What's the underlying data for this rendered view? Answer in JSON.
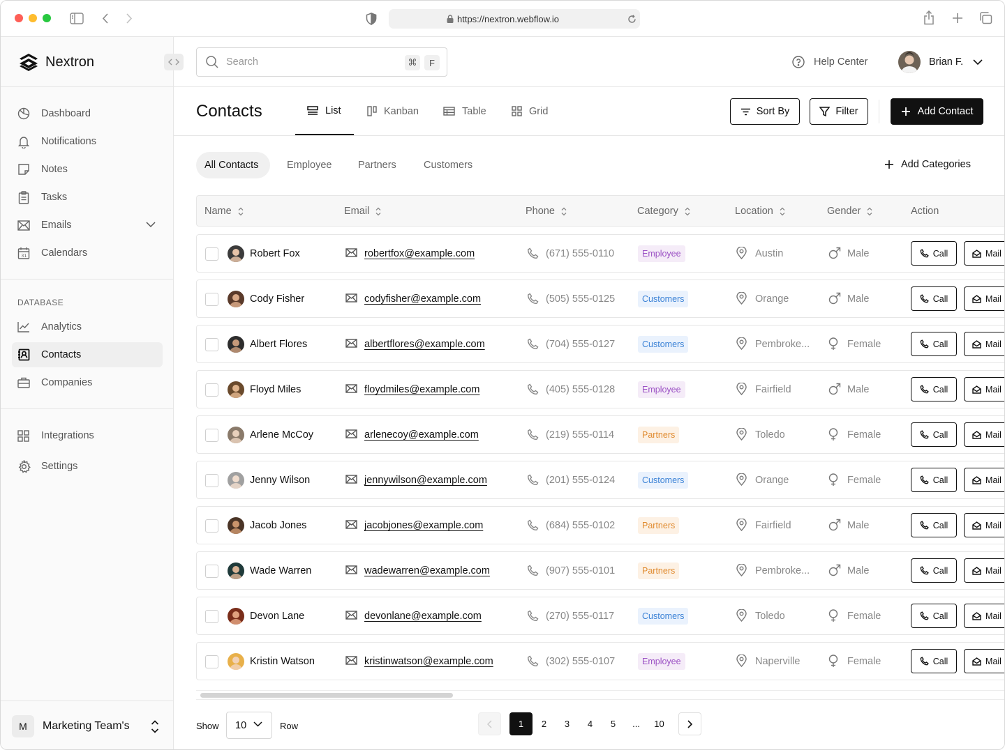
{
  "browser": {
    "url": "https://nextron.webflow.io"
  },
  "brand": {
    "name": "Nextron"
  },
  "sidebar": {
    "items": [
      {
        "label": "Dashboard",
        "icon": "dashboard-icon"
      },
      {
        "label": "Notifications",
        "icon": "bell-icon"
      },
      {
        "label": "Notes",
        "icon": "note-icon"
      },
      {
        "label": "Tasks",
        "icon": "clipboard-icon"
      },
      {
        "label": "Emails",
        "icon": "envelope-icon"
      },
      {
        "label": "Calendars",
        "icon": "calendar-icon"
      }
    ],
    "database_label": "DATABASE",
    "database_items": [
      {
        "label": "Analytics",
        "icon": "chart-line-icon"
      },
      {
        "label": "Contacts",
        "icon": "contact-book-icon",
        "active": true
      },
      {
        "label": "Companies",
        "icon": "briefcase-icon"
      }
    ],
    "bottom_items": [
      {
        "label": "Integrations",
        "icon": "grid-icon"
      },
      {
        "label": "Settings",
        "icon": "gear-icon"
      }
    ],
    "team": {
      "initial": "M",
      "name": "Marketing Team's"
    }
  },
  "header": {
    "search_placeholder": "Search",
    "shortcut_key1": "⌘",
    "shortcut_key2": "F",
    "help_label": "Help Center",
    "user_name": "Brian F."
  },
  "page": {
    "title": "Contacts",
    "views": [
      "List",
      "Kanban",
      "Table",
      "Grid"
    ],
    "active_view": "List",
    "sort_label": "Sort By",
    "filter_label": "Filter",
    "add_label": "Add Contact"
  },
  "categories": {
    "tabs": [
      "All Contacts",
      "Employee",
      "Partners",
      "Customers"
    ],
    "active": "All Contacts",
    "add_label": "Add Categories"
  },
  "table": {
    "columns": [
      "Name",
      "Email",
      "Phone",
      "Category",
      "Location",
      "Gender",
      "Action"
    ],
    "call_label": "Call",
    "mail_label": "Mail",
    "rows": [
      {
        "name": "Robert Fox",
        "email": "robertfox@example.com",
        "phone": "(671) 555-0110",
        "category": "Employee",
        "location": "Austin",
        "gender": "Male"
      },
      {
        "name": "Cody Fisher",
        "email": "codyfisher@example.com",
        "phone": "(505) 555-0125",
        "category": "Customers",
        "location": "Orange",
        "gender": "Male"
      },
      {
        "name": "Albert Flores",
        "email": "albertflores@example.com",
        "phone": "(704) 555-0127",
        "category": "Customers",
        "location": "Pembroke...",
        "gender": "Female"
      },
      {
        "name": "Floyd Miles",
        "email": "floydmiles@example.com",
        "phone": "(405) 555-0128",
        "category": "Employee",
        "location": "Fairfield",
        "gender": "Male"
      },
      {
        "name": "Arlene McCoy",
        "email": "arlenecoy@example.com",
        "phone": "(219) 555-0114",
        "category": "Partners",
        "location": "Toledo",
        "gender": "Female"
      },
      {
        "name": "Jenny Wilson",
        "email": "jennywilson@example.com",
        "phone": "(201) 555-0124",
        "category": "Customers",
        "location": "Orange",
        "gender": "Female"
      },
      {
        "name": "Jacob Jones",
        "email": "jacobjones@example.com",
        "phone": "(684) 555-0102",
        "category": "Partners",
        "location": "Fairfield",
        "gender": "Male"
      },
      {
        "name": "Wade Warren",
        "email": "wadewarren@example.com",
        "phone": "(907) 555-0101",
        "category": "Partners",
        "location": "Pembroke...",
        "gender": "Male"
      },
      {
        "name": "Devon Lane",
        "email": "devonlane@example.com",
        "phone": "(270) 555-0117",
        "category": "Customers",
        "location": "Toledo",
        "gender": "Female"
      },
      {
        "name": "Kristin Watson",
        "email": "kristinwatson@example.com",
        "phone": "(302) 555-0107",
        "category": "Employee",
        "location": "Naperville",
        "gender": "Female"
      }
    ]
  },
  "category_colors": {
    "Employee": {
      "bg": "#f5ecf8",
      "fg": "#9b51c4"
    },
    "Customers": {
      "bg": "#eaf2fd",
      "fg": "#3b82d6"
    },
    "Partners": {
      "bg": "#fdf1e4",
      "fg": "#e08a2e"
    }
  },
  "pagination": {
    "show_label": "Show",
    "rows_value": "10",
    "row_label": "Row",
    "pages": [
      "1",
      "2",
      "3",
      "4",
      "5",
      "...",
      "10"
    ],
    "current": "1"
  }
}
